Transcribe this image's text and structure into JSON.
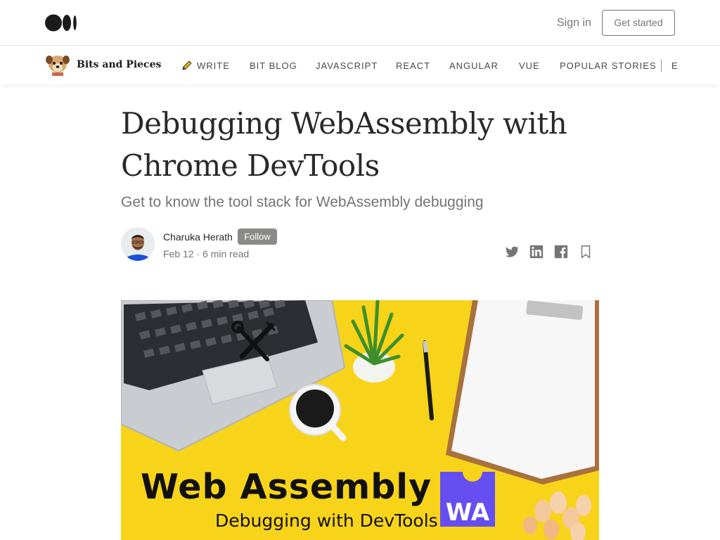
{
  "header": {
    "sign_in": "Sign in",
    "get_started": "Get started"
  },
  "publication": {
    "name": "Bits and Pieces",
    "nav": [
      "WRITE",
      "BIT BLOG",
      "JAVASCRIPT",
      "REACT",
      "ANGULAR",
      "VUE",
      "POPULAR STORIES"
    ],
    "nav_clipped": "E"
  },
  "article": {
    "title_line1": "Debugging WebAssembly with",
    "title_line2": "Chrome DevTools",
    "subtitle": "Get to know the tool stack for WebAssembly debugging",
    "author": "Charuka Herath",
    "follow": "Follow",
    "date": "Feb 12",
    "separator": "·",
    "read_time": "6 min read"
  },
  "share_icons": [
    "twitter-icon",
    "linkedin-icon",
    "facebook-icon",
    "bookmark-icon"
  ],
  "hero": {
    "heading": "Web Assembly",
    "subheading": "Debugging with DevTools",
    "badge": "WA"
  },
  "colors": {
    "follow_bg": "#8a8a87",
    "hero_bg": "#f7d31a",
    "badge_bg": "#654ff0"
  }
}
